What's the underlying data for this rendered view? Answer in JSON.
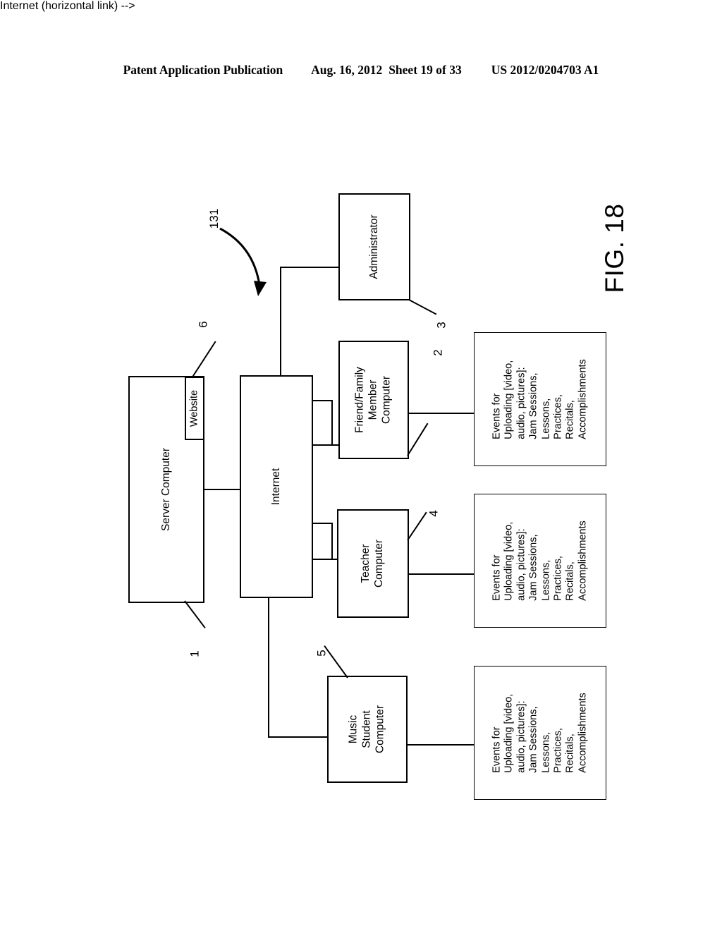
{
  "header": {
    "publication": "Patent Application Publication",
    "date": "Aug. 16, 2012",
    "sheet": "Sheet 19 of 33",
    "document_number": "US 2012/0204703 A1"
  },
  "figure": {
    "caption": "FIG. 18",
    "system_numeral": "131"
  },
  "nodes": {
    "server_computer": {
      "label": "Server Computer",
      "numeral": "1"
    },
    "website": {
      "label": "Website",
      "numeral": "6"
    },
    "internet": {
      "label": "Internet"
    },
    "administrator": {
      "label": "Administrator",
      "numeral": "3"
    },
    "friend_family_computer": {
      "label_lines": [
        "Friend/Family",
        "Member",
        "Computer"
      ],
      "numeral": "2"
    },
    "teacher_computer": {
      "label_lines": [
        "Teacher",
        "Computer"
      ],
      "numeral": "4"
    },
    "music_student_computer": {
      "label_lines": [
        "Music",
        "Student",
        "Computer"
      ],
      "numeral": "5"
    }
  },
  "events_box": {
    "lines": [
      "Events for",
      "Uploading [video,",
      "audio, pictures]:",
      "Jam Sessions,",
      "Lessons,",
      "Practices,",
      "Recitals,",
      "Accomplishments"
    ]
  },
  "colors": {
    "ink": "#000000",
    "paper": "#ffffff"
  }
}
